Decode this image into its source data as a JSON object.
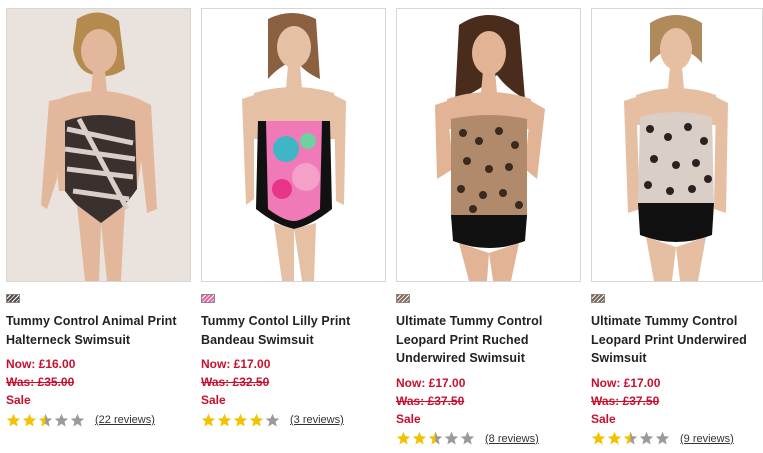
{
  "products": [
    {
      "title": "Tummy Control Animal Print Halterneck Swimsuit",
      "now": "Now: £16.00",
      "was": "Was: £35.00",
      "sale": "Sale",
      "rating": 2.5,
      "reviews": "(22 reviews)",
      "swatch_color": "#5a4a48",
      "suit": "zebra"
    },
    {
      "title": "Tummy Contol Lilly Print Bandeau Swimsuit",
      "now": "Now: £17.00",
      "was": "Was: £32.50",
      "sale": "Sale",
      "rating": 4,
      "reviews": "(3 reviews)",
      "swatch_color": "#e06aa8",
      "suit": "floral"
    },
    {
      "title": "Ultimate Tummy Control Leopard Print Ruched Underwired Swimsuit",
      "now": "Now: £17.00",
      "was": "Was: £37.50",
      "sale": "Sale",
      "rating": 2.5,
      "reviews": "(8 reviews)",
      "swatch_color": "#8a6a55",
      "suit": "leopard-dark"
    },
    {
      "title": "Ultimate Tummy Control Leopard Print Underwired Swimsuit",
      "now": "Now: £17.00",
      "was": "Was: £37.50",
      "sale": "Sale",
      "rating": 2.5,
      "reviews": "(9 reviews)",
      "swatch_color": "#7a6258",
      "suit": "leopard-light"
    }
  ],
  "colors": {
    "price": "#c8102e",
    "star_on": "#f2c200",
    "star_off": "#9a9a9a"
  }
}
